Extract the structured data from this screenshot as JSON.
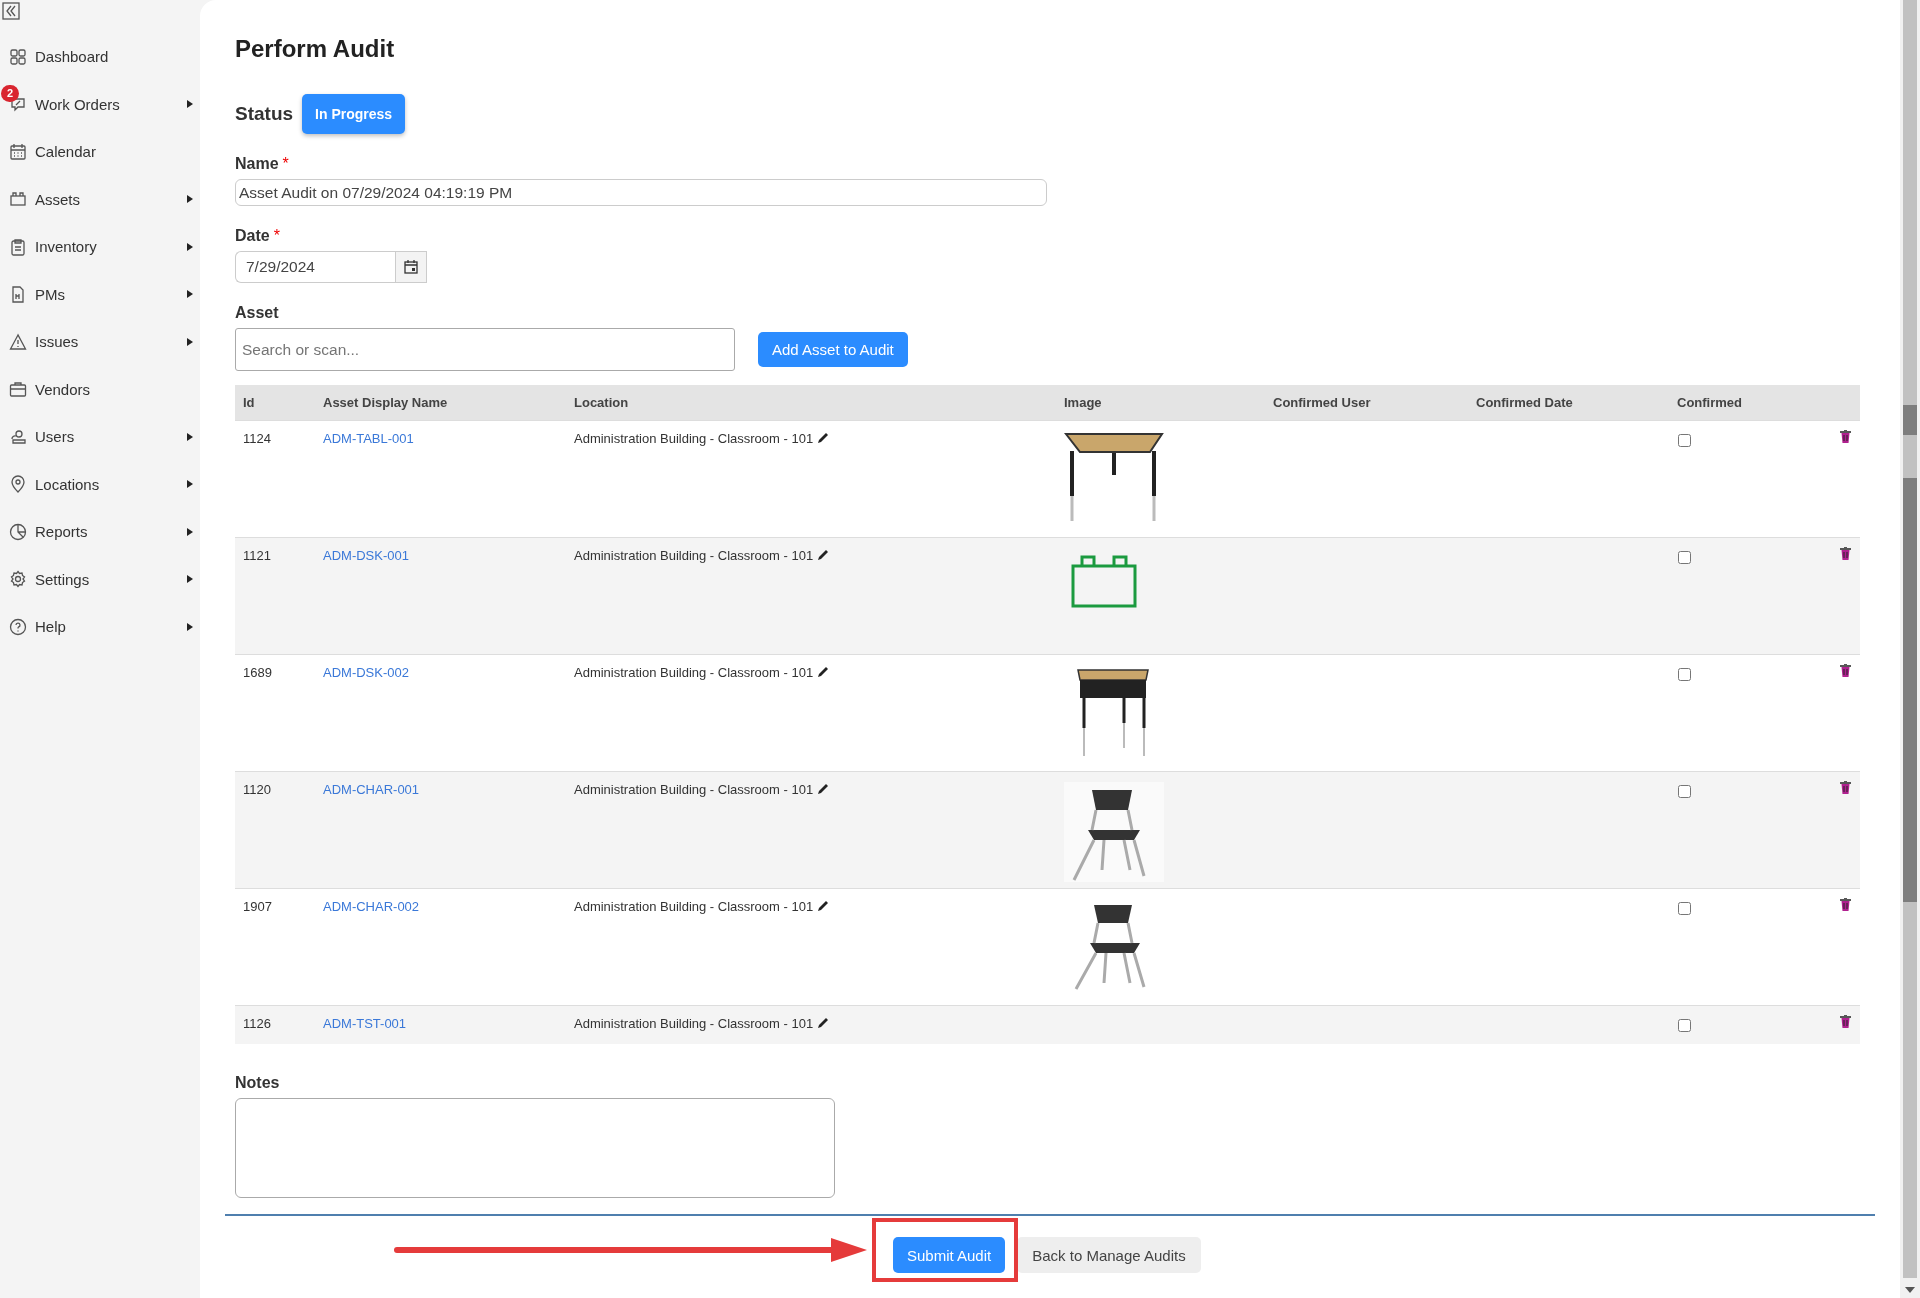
{
  "sidebar": {
    "items": [
      {
        "label": "Dashboard",
        "has_submenu": false
      },
      {
        "label": "Work Orders",
        "has_submenu": true,
        "badge": "2"
      },
      {
        "label": "Calendar",
        "has_submenu": false
      },
      {
        "label": "Assets",
        "has_submenu": true
      },
      {
        "label": "Inventory",
        "has_submenu": true
      },
      {
        "label": "PMs",
        "has_submenu": true
      },
      {
        "label": "Issues",
        "has_submenu": true
      },
      {
        "label": "Vendors",
        "has_submenu": false
      },
      {
        "label": "Users",
        "has_submenu": true
      },
      {
        "label": "Locations",
        "has_submenu": true
      },
      {
        "label": "Reports",
        "has_submenu": true
      },
      {
        "label": "Settings",
        "has_submenu": true
      },
      {
        "label": "Help",
        "has_submenu": true
      }
    ]
  },
  "page": {
    "title": "Perform Audit"
  },
  "status": {
    "label": "Status",
    "value": "In Progress"
  },
  "name": {
    "label": "Name",
    "required_mark": "*",
    "value": "Asset Audit on 07/29/2024 04:19:19 PM"
  },
  "date": {
    "label": "Date",
    "required_mark": "*",
    "value": "7/29/2024"
  },
  "asset": {
    "label": "Asset",
    "placeholder": "Search or scan...",
    "button": "Add Asset to Audit"
  },
  "table": {
    "columns": [
      "Id",
      "Asset Display Name",
      "Location",
      "Image",
      "Confirmed User",
      "Confirmed Date",
      "Confirmed"
    ],
    "rows": [
      {
        "id": "1124",
        "name": "ADM-TABL-001",
        "location": "Administration Building - Classroom - 101",
        "kind": "photo",
        "confirmed": false
      },
      {
        "id": "1121",
        "name": "ADM-DSK-001",
        "location": "Administration Building - Classroom - 101",
        "kind": "icon",
        "confirmed": false
      },
      {
        "id": "1689",
        "name": "ADM-DSK-002",
        "location": "Administration Building - Classroom - 101",
        "kind": "photo",
        "confirmed": false
      },
      {
        "id": "1120",
        "name": "ADM-CHAR-001",
        "location": "Administration Building - Classroom - 101",
        "kind": "photo",
        "confirmed": false
      },
      {
        "id": "1907",
        "name": "ADM-CHAR-002",
        "location": "Administration Building - Classroom - 101",
        "kind": "photo",
        "confirmed": false
      },
      {
        "id": "1126",
        "name": "ADM-TST-001",
        "location": "Administration Building - Classroom - 101",
        "kind": "none",
        "confirmed": false
      }
    ]
  },
  "notes": {
    "label": "Notes"
  },
  "footer": {
    "buttons": [
      {
        "label": "Submit Audit",
        "kind": "primary",
        "highlighted": true
      },
      {
        "label": "Back to Manage Audits",
        "kind": "secondary",
        "highlighted": false
      }
    ]
  }
}
